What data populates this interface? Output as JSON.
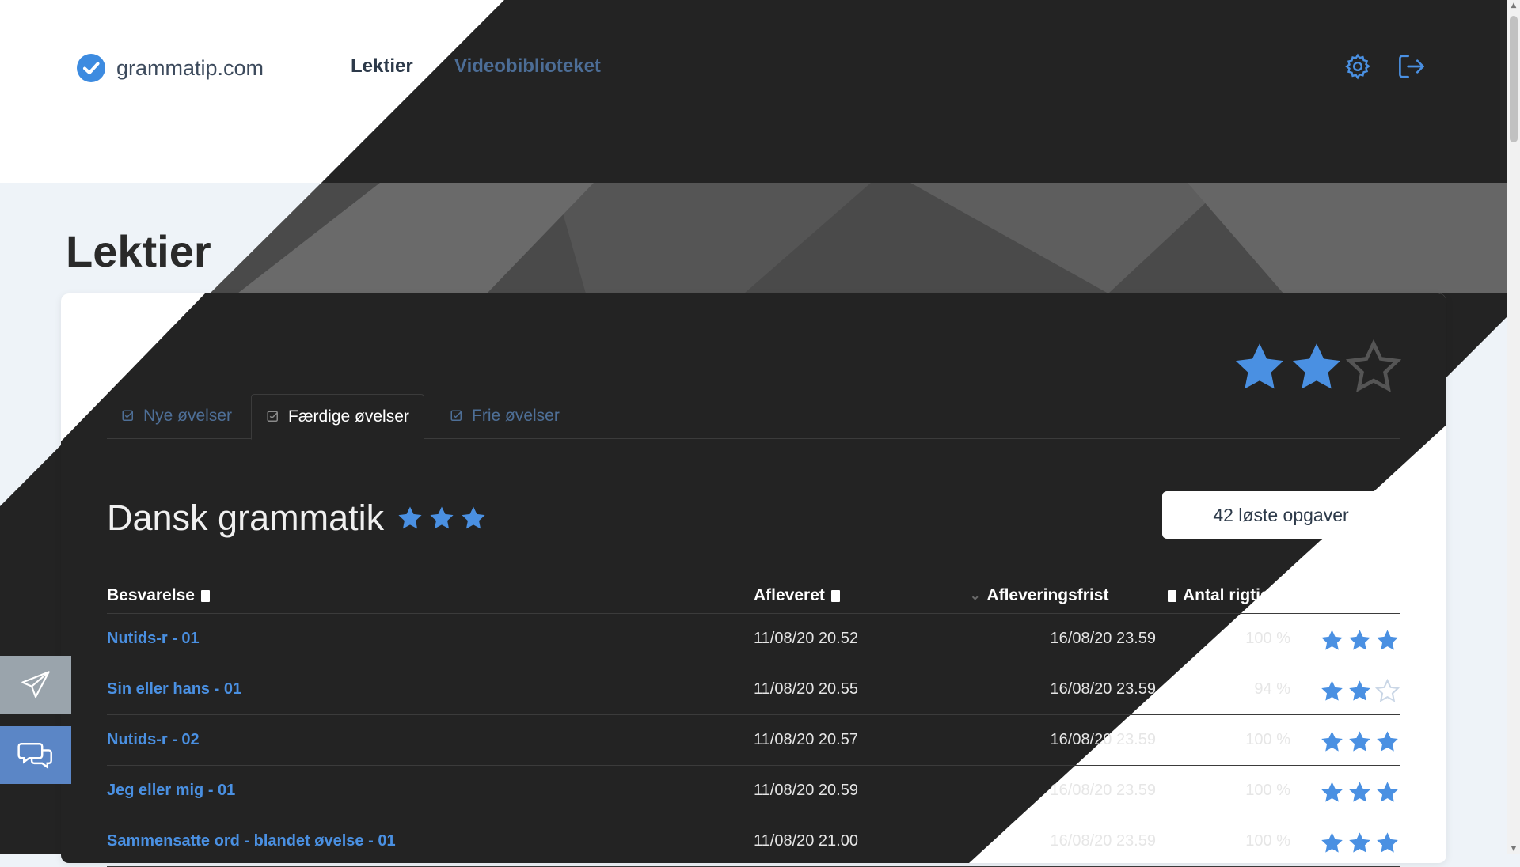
{
  "brand": {
    "name": "grammatip.com",
    "accent": "#4a90e2"
  },
  "nav": {
    "items": [
      "Lektier",
      "Videobiblioteket"
    ]
  },
  "page": {
    "title": "Lektier"
  },
  "tabs": [
    "Nye øvelser",
    "Færdige øvelser",
    "Frie øvelser"
  ],
  "active_tab": "Færdige øvelser",
  "section": {
    "title": "Dansk grammatik",
    "stars": 3,
    "solved_label": "42 løste opgaver"
  },
  "overall_stars": 2,
  "table": {
    "headers": [
      "Besvarelse",
      "Afleveret",
      "Afleveringsfrist",
      "Antal rigtige"
    ],
    "rows": [
      {
        "name": "Nutids-r - 01",
        "submitted": "11/08/20 20.52",
        "deadline": "16/08/20 23.59",
        "correct": "100 %",
        "stars": 3
      },
      {
        "name": "Sin eller hans - 01",
        "submitted": "11/08/20 20.55",
        "deadline": "16/08/20 23.59",
        "correct": "94 %",
        "stars": 2
      },
      {
        "name": "Nutids-r - 02",
        "submitted": "11/08/20 20.57",
        "deadline": "16/08/20 23.59",
        "correct": "100 %",
        "stars": 3
      },
      {
        "name": "Jeg eller mig - 01",
        "submitted": "11/08/20 20.59",
        "deadline": "16/08/20 23.59",
        "correct": "100 %",
        "stars": 3
      },
      {
        "name": "Sammensatte ord - blandet øvelse - 01",
        "submitted": "11/08/20 21.00",
        "deadline": "16/08/20 23.59",
        "correct": "100 %",
        "stars": 3
      }
    ]
  },
  "icons": {
    "logo": "check-circle-icon",
    "settings": "gear-icon",
    "logout": "logout-icon",
    "send": "paper-plane-icon",
    "chat": "chat-bubbles-icon",
    "tab": "edit-check-icon",
    "sort": "sort-icon"
  }
}
